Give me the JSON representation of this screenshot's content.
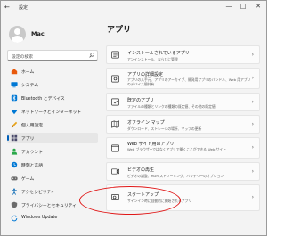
{
  "window": {
    "title": "設定",
    "back": "←",
    "minimize": "—",
    "maximize": "□",
    "close": "✕"
  },
  "user": {
    "name": "Mac"
  },
  "search": {
    "placeholder": "設定の検索"
  },
  "sidebar": {
    "items": [
      {
        "label": "ホーム",
        "icon": "home-icon",
        "color": "#e8590c"
      },
      {
        "label": "システム",
        "icon": "monitor-icon",
        "color": "#0078d4"
      },
      {
        "label": "Bluetooth とデバイス",
        "icon": "bluetooth-icon",
        "color": "#0078d4"
      },
      {
        "label": "ネットワークとインターネット",
        "icon": "wifi-icon",
        "color": "#0078d4"
      },
      {
        "label": "個人用設定",
        "icon": "brush-icon",
        "color": "#e8a317"
      },
      {
        "label": "アプリ",
        "icon": "apps-icon",
        "color": "#4a4a6a",
        "selected": true
      },
      {
        "label": "アカウント",
        "icon": "person-icon",
        "color": "#2ba84a"
      },
      {
        "label": "時刻と言語",
        "icon": "globe-clock-icon",
        "color": "#0078d4"
      },
      {
        "label": "ゲーム",
        "icon": "gamepad-icon",
        "color": "#6b6b6b"
      },
      {
        "label": "アクセシビリティ",
        "icon": "accessibility-icon",
        "color": "#0063b1"
      },
      {
        "label": "プライバシーとセキュリティ",
        "icon": "shield-icon",
        "color": "#6b6b6b"
      },
      {
        "label": "Windows Update",
        "icon": "update-icon",
        "color": "#0078d4"
      }
    ]
  },
  "main": {
    "title": "アプリ",
    "cards": [
      {
        "title": "インストールされているアプリ",
        "desc": "アンインストール、ならびに管理",
        "icon": "installed-apps-icon"
      },
      {
        "title": "アプリの詳細設定",
        "desc": "アプリの入手元、アプリのアーカイブ、開発用アプリのバンドル、Web 用アプリのデバイス間共有",
        "icon": "app-settings-icon"
      },
      {
        "title": "既定のアプリ",
        "desc": "ファイルの種類とリンクの種類の既定値、その他の既定値",
        "icon": "default-apps-icon"
      },
      {
        "title": "オフライン マップ",
        "desc": "ダウンロード、ストレージの場所、マップの更新",
        "icon": "offline-map-icon"
      },
      {
        "title": "Web サイト用のアプリ",
        "desc": "Web ブラウザーではなくアプリで開くことができる Web サイト",
        "icon": "web-apps-icon"
      },
      {
        "title": "ビデオの再生",
        "desc": "ビデオの調整、HDR ストリーミング、バッテリーのオプション",
        "icon": "video-icon"
      },
      {
        "title": "スタートアップ",
        "desc": "サインイン時に自動的に開始されるアプリ",
        "icon": "startup-icon"
      }
    ]
  }
}
